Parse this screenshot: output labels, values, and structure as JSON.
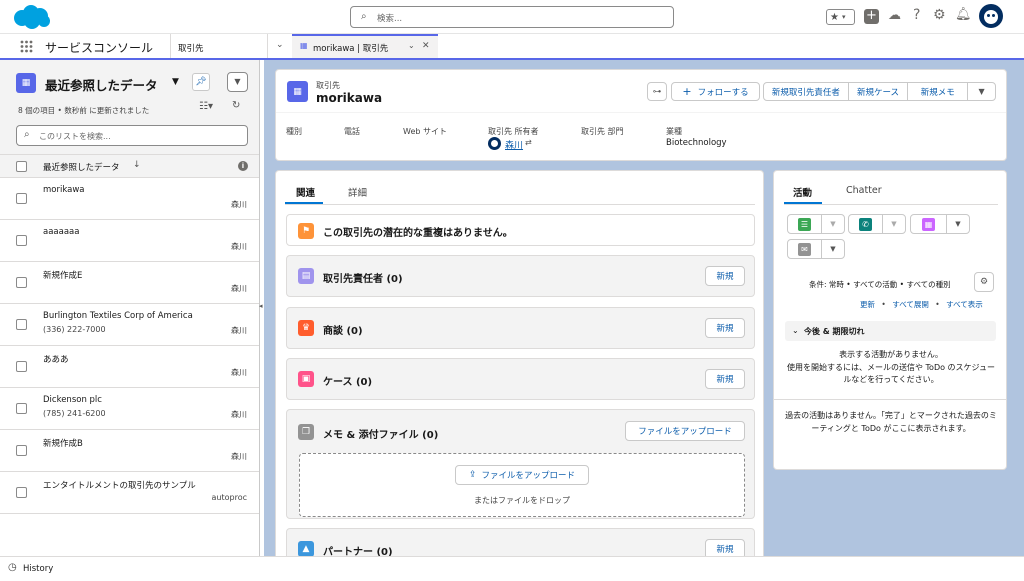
{
  "global_header": {
    "search_placeholder": "検索...",
    "brand_color": "#00a1e0"
  },
  "nav": {
    "app_name": "サービスコンソール",
    "object_tab": "取引先",
    "subtab_label": "morikawa | 取引先"
  },
  "list_panel": {
    "title": "最近参照したデータ",
    "meta": "8 個の項目 • 数秒前 に更新されました",
    "search_placeholder": "このリストを検索...",
    "column_header": "最近参照したデータ",
    "sort_indicator": "↓",
    "rows": [
      {
        "name": "morikawa",
        "sub": "",
        "owner": "森川"
      },
      {
        "name": "aaaaaaa",
        "sub": "",
        "owner": "森川"
      },
      {
        "name": "新規作成E",
        "sub": "",
        "owner": "森川"
      },
      {
        "name": "Burlington Textiles Corp of America",
        "sub": "(336) 222-7000",
        "owner": "森川"
      },
      {
        "name": "あああ",
        "sub": "",
        "owner": "森川"
      },
      {
        "name": "Dickenson plc",
        "sub": "(785) 241-6200",
        "owner": "森川"
      },
      {
        "name": "新規作成B",
        "sub": "",
        "owner": "森川"
      },
      {
        "name": "エンタイトルメントの取引先のサンプル",
        "sub": "",
        "owner": "autoproc"
      }
    ]
  },
  "record": {
    "object_label": "取引先",
    "name": "morikawa",
    "follow_label": "フォローする",
    "actions": [
      "新規取引先責任者",
      "新規ケース",
      "新規メモ"
    ],
    "fields": [
      {
        "label": "種別",
        "value": ""
      },
      {
        "label": "電話",
        "value": ""
      },
      {
        "label": "Web サイト",
        "value": ""
      },
      {
        "label": "取引先 所有者",
        "value": "森川"
      },
      {
        "label": "取引先 部門",
        "value": ""
      },
      {
        "label": "業種",
        "value": "Biotechnology"
      }
    ]
  },
  "related": {
    "tabs": [
      "関連",
      "詳細"
    ],
    "duplicate_msg": "この取引先の潜在的な重複はありません。",
    "contacts": {
      "title": "取引先責任者 (0)",
      "button": "新規"
    },
    "opportunities": {
      "title": "商談 (0)",
      "button": "新規"
    },
    "cases": {
      "title": "ケース (0)",
      "button": "新規"
    },
    "notes": {
      "title": "メモ & 添付ファイル (0)",
      "upload_button": "ファイルをアップロード",
      "dropzone_button": "ファイルをアップロード",
      "drop_text": "またはファイルをドロップ"
    },
    "partners": {
      "title": "パートナー (0)",
      "button": "新規"
    }
  },
  "activity": {
    "tabs": [
      "活動",
      "Chatter"
    ],
    "filter_text": "条件: 常時 • すべての活動 • すべての種別",
    "links": [
      "更新",
      "すべて展開",
      "すべて表示"
    ],
    "link_separator": "•",
    "upcoming_title": "今後 & 期限切れ",
    "no_activity": "表示する活動がありません。",
    "hint": "使用を開始するには、メールの送信や ToDo のスケジュールなどを行ってください。",
    "past": "過去の活動はありません。「完了」とマークされた過去のミーティングと ToDo がここに表示されます。"
  },
  "footer": {
    "history_label": "History"
  }
}
